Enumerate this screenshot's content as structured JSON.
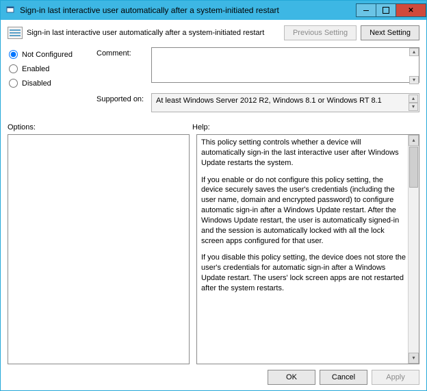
{
  "window": {
    "title": "Sign-in last interactive user automatically after a system-initiated restart"
  },
  "header": {
    "policy_name": "Sign-in last interactive user automatically after a system-initiated restart",
    "previous_setting": "Previous Setting",
    "next_setting": "Next Setting"
  },
  "state": {
    "options": {
      "not_configured": "Not Configured",
      "enabled": "Enabled",
      "disabled": "Disabled"
    },
    "selected": "not_configured"
  },
  "comment": {
    "label": "Comment:",
    "value": ""
  },
  "supported": {
    "label": "Supported on:",
    "value": "At least Windows Server 2012 R2, Windows 8.1 or Windows RT 8.1"
  },
  "panes": {
    "options_label": "Options:",
    "help_label": "Help:"
  },
  "help": {
    "p1": "This policy setting controls whether a device will automatically sign-in the last interactive user after Windows Update restarts the system.",
    "p2": "If you enable or do not configure this policy setting, the device securely saves the user's credentials (including the user name, domain and encrypted password) to configure automatic sign-in after a Windows Update restart. After the Windows Update restart, the user is automatically signed-in and the session is automatically locked with all the lock screen apps configured for that user.",
    "p3": "If you disable this policy setting, the device does not store the user's credentials for automatic sign-in after a Windows Update restart. The users' lock screen apps are not restarted after the system restarts."
  },
  "buttons": {
    "ok": "OK",
    "cancel": "Cancel",
    "apply": "Apply"
  }
}
